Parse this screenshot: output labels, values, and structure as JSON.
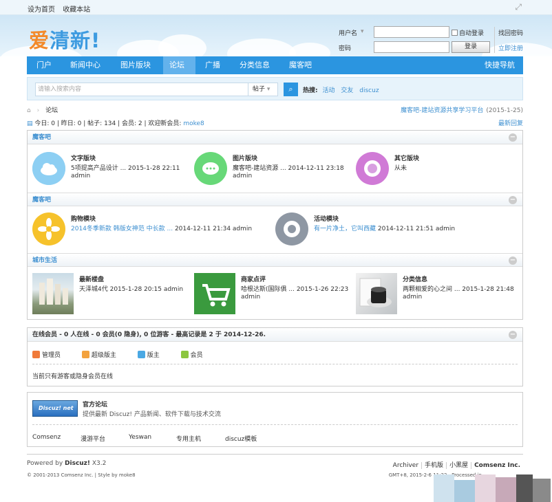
{
  "topbar": {
    "set_home": "设为首页",
    "bookmark": "收藏本站"
  },
  "logo": {
    "part1": "爱",
    "part2": "清新!"
  },
  "login": {
    "username_label": "用户名",
    "password_label": "密码",
    "auto_login": "自动登录",
    "login_button": "登录",
    "forgot_password": "找回密码",
    "register": "立即注册"
  },
  "nav": {
    "items": [
      "门户",
      "新闻中心",
      "图片版块",
      "论坛",
      "广播",
      "分类信息",
      "魔客吧"
    ],
    "quick_nav": "快捷导航"
  },
  "search": {
    "placeholder": "请输入搜索内容",
    "type": "帖子",
    "hot_label": "热搜:",
    "hot": [
      "活动",
      "交友",
      "discuz"
    ]
  },
  "breadcrumb": {
    "current": "论坛",
    "announcement": "魔客吧-建站资源共享学习平台",
    "announcement_date": "(2015-1-25)"
  },
  "stats": {
    "today": "今日: 0",
    "yesterday": "昨日: 0",
    "posts": "帖子: 134",
    "members": "会员: 2",
    "welcome": "欢迎新会员: ",
    "newest_member": "moke8",
    "latest_replies": "最新回复"
  },
  "sections": [
    {
      "title": "魔客吧",
      "forums": [
        {
          "name": "文字版块",
          "last": "5项提高产品设计 ... 2015-1-28 22:11",
          "author": "admin"
        },
        {
          "name": "图片版块",
          "last": "魔客吧-建站资源 ... 2014-12-11 23:18",
          "author": "admin"
        },
        {
          "name": "其它版块",
          "last": "从未",
          "author": ""
        }
      ]
    },
    {
      "title": "魔客吧",
      "forums": [
        {
          "name": "购物模块",
          "link": "2014冬季新款 韩版女神范 中长款 ...",
          "last": " 2014-12-11 21:34 admin"
        },
        {
          "name": "活动模块",
          "link": "有一片净土，它叫西藏",
          "last": " 2014-12-11 21:51 admin"
        }
      ]
    },
    {
      "title": "城市生活",
      "forums": [
        {
          "name": "最新楼盘",
          "last": "天泽城4代 2015-1-28 20:15 admin",
          "author": ""
        },
        {
          "name": "商家点评",
          "last": "哈根达斯(国际俱 ... 2015-1-26 22:23",
          "author": "admin"
        },
        {
          "name": "分类信息",
          "last": "两颗相爱的心之间 ... 2015-1-28 21:48",
          "author": "admin"
        }
      ]
    }
  ],
  "online": {
    "header": "在线会员 - 0 人在线 - 0 会员(0 隐身), 0 位游客 - 最高记录是 2 于 2014-12-26.",
    "roles": [
      "管理员",
      "超级版主",
      "版主",
      "会员"
    ],
    "empty": "当前只有游客或隐身会员在线"
  },
  "links": {
    "logo_text": "Discuz! net",
    "title": "官方论坛",
    "desc": "提供最新 Discuz! 产品新闻、软件下载与技术交流",
    "items": [
      "Comsenz",
      "漫游平台",
      "Yeswan",
      "专用主机",
      "discuz模板"
    ]
  },
  "footer": {
    "powered": "Powered by ",
    "brand": "Discuz!",
    "version": " X3.2",
    "copyright": "© 2001-2013 Comsenz Inc.   |   Style by moke8",
    "links": [
      "Archiver",
      "手机版",
      "小黑屋",
      "Comsenz Inc."
    ],
    "gmt": "GMT+8, 2015-2-6 11:22 , Processed in"
  }
}
